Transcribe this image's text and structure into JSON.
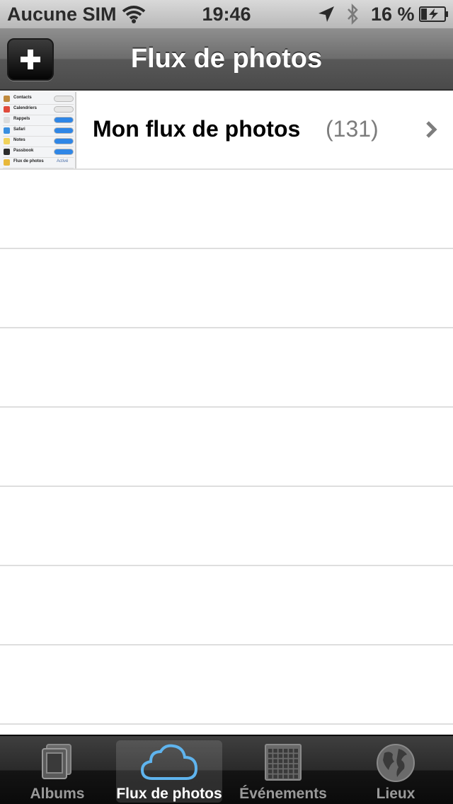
{
  "status_bar": {
    "carrier": "Aucune SIM",
    "time": "19:46",
    "battery": "16 %",
    "icons": [
      "wifi-icon",
      "location-arrow-icon",
      "bluetooth-icon",
      "battery-charging-icon"
    ]
  },
  "nav": {
    "title": "Flux de photos",
    "add_button_icon": "plus-icon"
  },
  "streams": [
    {
      "name": "Mon flux de photos",
      "count": "(131)",
      "thumbnail": {
        "items": [
          {
            "label": "Contacts",
            "icon_color": "#c08a3e",
            "toggle": "off"
          },
          {
            "label": "Calendriers",
            "icon_color": "#e04b3b",
            "toggle": "off"
          },
          {
            "label": "Rappels",
            "icon_color": "#dcdcdc",
            "toggle": "on"
          },
          {
            "label": "Safari",
            "icon_color": "#3a8fe0",
            "toggle": "on"
          },
          {
            "label": "Notes",
            "icon_color": "#f0d25a",
            "toggle": "on"
          },
          {
            "label": "Passbook",
            "icon_color": "#2c2c2c",
            "toggle": "on"
          },
          {
            "label": "Flux de photos",
            "icon_color": "#e8b83a",
            "value": "Activé"
          }
        ]
      }
    }
  ],
  "tabs": [
    {
      "label": "Albums",
      "icon": "albums-icon",
      "active": false
    },
    {
      "label": "Flux de photos",
      "icon": "cloud-icon",
      "active": true
    },
    {
      "label": "Événements",
      "icon": "calendar-grid-icon",
      "active": false
    },
    {
      "label": "Lieux",
      "icon": "globe-icon",
      "active": false
    }
  ],
  "colors": {
    "navbar": "#5a5a5a",
    "active_cloud": "#5fb4ee",
    "toggle_on": "#2f86e6",
    "count_text": "#7c7c7c"
  }
}
